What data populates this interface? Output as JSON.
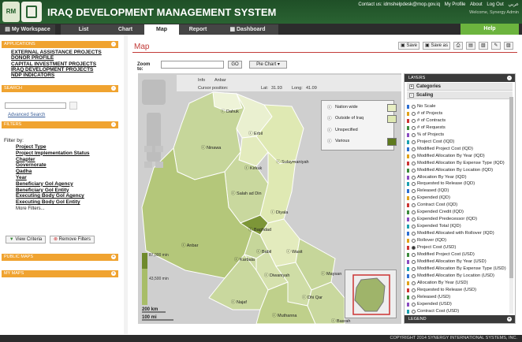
{
  "header": {
    "logo_text": "RM",
    "title": "IRAQ DEVELOPMENT MANAGEMENT SYSTEM",
    "contact": "Contact us: idmshelpdesk@mop.gov.iq",
    "links": [
      "My Profile",
      "About",
      "Log Out",
      "عربي"
    ],
    "welcome": "Welcome, Synergy Admin"
  },
  "nav": {
    "workspace": "My Workspace",
    "tabs": [
      "List",
      "Chart",
      "Map",
      "Report",
      "Dashboard"
    ],
    "help": "Help"
  },
  "sidebar": {
    "applications": {
      "title": "APPLICATIONS",
      "items": [
        "EXTERNAL ASSISTANCE PROJECTS",
        "DONOR PROFILE",
        "CAPITAL INVESTMENT PROJECTS",
        "IRAQ DEVELOPMENT PROJECTS",
        "NDP INDICATORS"
      ]
    },
    "search": {
      "title": "SEARCH",
      "advanced": "Advanced Search"
    },
    "filters": {
      "title": "FILTERS",
      "filter_by": "Filter by:",
      "items": [
        "Project Type",
        "Project Implementation Status",
        "Chapter",
        "Governorate",
        "Qadha",
        "Year",
        "Beneficiary GoI Agency",
        "Beneficiary GoI Entity",
        "Executing Body GoI Agency",
        "Executing Body GoI Entity"
      ],
      "more": "More Filters...",
      "view": "View Criteria",
      "remove": "Remove Filters"
    },
    "public_maps": "PUBLIC MAPS",
    "my_maps": "MY MAPS"
  },
  "map": {
    "title": "Map",
    "toolbar": {
      "save": "Save",
      "save_as": "Save as"
    },
    "zoom_to": "Zoom to:",
    "go": "GO",
    "pie_chart": "Pie Chart",
    "info": {
      "label": "Info",
      "value": "Anbar",
      "cursor": "Cursor position:",
      "lat_label": "Lat:",
      "lat": "31.93",
      "long_label": "Long:",
      "long": "41.09"
    },
    "legend": [
      {
        "label": "Nation wide",
        "color": "#e8efc3"
      },
      {
        "label": "Outside of Iraq",
        "color": "#dfe9b3"
      },
      {
        "label": "Unspecified",
        "color": "#ffffff"
      },
      {
        "label": "Various",
        "color": "#5e7a1e"
      }
    ],
    "ramp": {
      "top": "87,000 min",
      "mid": "43,500 min"
    },
    "scale": {
      "km": "200 km",
      "mi": "100 mi"
    },
    "places": [
      "Dahuk",
      "Erbil",
      "Ninawa",
      "Sulaymaniyah",
      "Kirkuk",
      "Salah ad Din",
      "Diyala",
      "Anbar",
      "Baghdad",
      "Babil",
      "Wasit",
      "Karbala",
      "Diwaniyah",
      "Maysan",
      "Najaf",
      "Dhi Qar",
      "Basrah",
      "Muthanna"
    ]
  },
  "layers": {
    "title": "LAYERS",
    "categories": "Categories",
    "scaling": "Scaling",
    "legend_title": "LEGEND",
    "items": [
      "No Scale",
      "# of Projects",
      "# of Contracts",
      "# of Requests",
      "% of Projects",
      "Project Cost (IQD)",
      "Modified Project Cost (IQD)",
      "Modified Allocation By Year (IQD)",
      "Modified Allocation By Expense Type (IQD)",
      "Modified Allocation By Location (IQD)",
      "Allocation By Year (IQD)",
      "Requested to Release (IQD)",
      "Released (IQD)",
      "Expended (IQD)",
      "Contract Cost (IQD)",
      "Expended Credit (IQD)",
      "Expended Predecessor (IQD)",
      "Expended Total (IQD)",
      "Modified Allocated with Rollover (IQD)",
      "Rollover (IQD)",
      "Project Cost (USD)",
      "Modified Project Cost (USD)",
      "Modified Allocation By Year (USD)",
      "Modified Allocation By Expense Type (USD)",
      "Modified Allocation By Location (USD)",
      "Allocation By Year (USD)",
      "Requested to Release (USD)",
      "Released (USD)",
      "Expended (USD)",
      "Contract Cost (USD)"
    ],
    "selected": "Project Cost (USD)"
  },
  "footer": "COPYRIGHT 2014 SYNERGY INTERNATIONAL SYSTEMS, INC."
}
